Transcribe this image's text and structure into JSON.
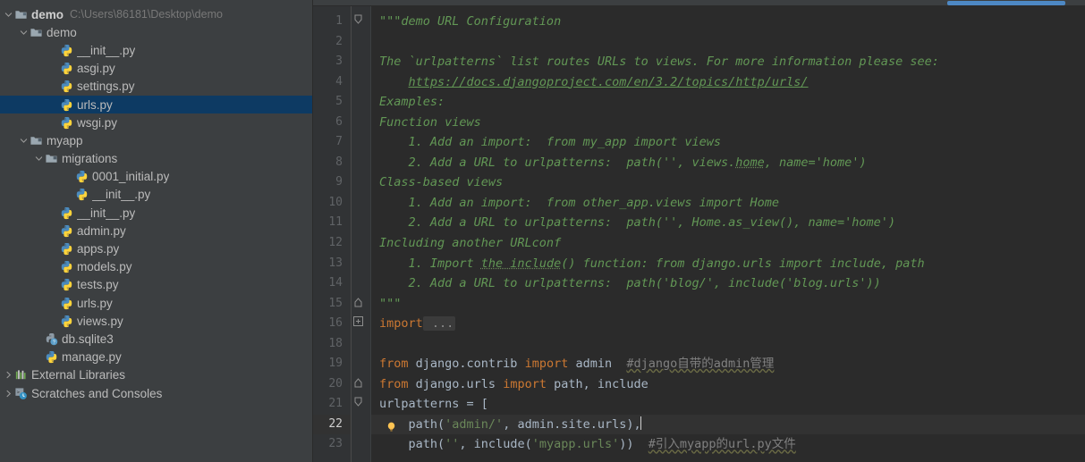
{
  "sidebar": {
    "items": [
      {
        "indent": 0,
        "arrow": "chevron-down",
        "icon": "folder-module",
        "label": "demo",
        "bold": true,
        "path": "C:\\Users\\86181\\Desktop\\demo",
        "selected": false
      },
      {
        "indent": 1,
        "arrow": "chevron-down",
        "icon": "folder-package",
        "label": "demo",
        "bold": false,
        "path": "",
        "selected": false
      },
      {
        "indent": 3,
        "arrow": "none",
        "icon": "python-file",
        "label": "__init__.py",
        "bold": false,
        "path": "",
        "selected": false
      },
      {
        "indent": 3,
        "arrow": "none",
        "icon": "python-file",
        "label": "asgi.py",
        "bold": false,
        "path": "",
        "selected": false
      },
      {
        "indent": 3,
        "arrow": "none",
        "icon": "python-file",
        "label": "settings.py",
        "bold": false,
        "path": "",
        "selected": false
      },
      {
        "indent": 3,
        "arrow": "none",
        "icon": "python-file",
        "label": "urls.py",
        "bold": false,
        "path": "",
        "selected": true
      },
      {
        "indent": 3,
        "arrow": "none",
        "icon": "python-file",
        "label": "wsgi.py",
        "bold": false,
        "path": "",
        "selected": false
      },
      {
        "indent": 1,
        "arrow": "chevron-down",
        "icon": "folder-package",
        "label": "myapp",
        "bold": false,
        "path": "",
        "selected": false
      },
      {
        "indent": 2,
        "arrow": "chevron-down",
        "icon": "folder-package",
        "label": "migrations",
        "bold": false,
        "path": "",
        "selected": false
      },
      {
        "indent": 4,
        "arrow": "none",
        "icon": "python-file",
        "label": "0001_initial.py",
        "bold": false,
        "path": "",
        "selected": false
      },
      {
        "indent": 4,
        "arrow": "none",
        "icon": "python-file",
        "label": "__init__.py",
        "bold": false,
        "path": "",
        "selected": false
      },
      {
        "indent": 3,
        "arrow": "none",
        "icon": "python-file",
        "label": "__init__.py",
        "bold": false,
        "path": "",
        "selected": false
      },
      {
        "indent": 3,
        "arrow": "none",
        "icon": "python-file",
        "label": "admin.py",
        "bold": false,
        "path": "",
        "selected": false
      },
      {
        "indent": 3,
        "arrow": "none",
        "icon": "python-file",
        "label": "apps.py",
        "bold": false,
        "path": "",
        "selected": false
      },
      {
        "indent": 3,
        "arrow": "none",
        "icon": "python-file",
        "label": "models.py",
        "bold": false,
        "path": "",
        "selected": false
      },
      {
        "indent": 3,
        "arrow": "none",
        "icon": "python-file",
        "label": "tests.py",
        "bold": false,
        "path": "",
        "selected": false
      },
      {
        "indent": 3,
        "arrow": "none",
        "icon": "python-file",
        "label": "urls.py",
        "bold": false,
        "path": "",
        "selected": false
      },
      {
        "indent": 3,
        "arrow": "none",
        "icon": "python-file",
        "label": "views.py",
        "bold": false,
        "path": "",
        "selected": false
      },
      {
        "indent": 2,
        "arrow": "none",
        "icon": "unknown-file",
        "label": "db.sqlite3",
        "bold": false,
        "path": "",
        "selected": false
      },
      {
        "indent": 2,
        "arrow": "none",
        "icon": "python-file",
        "label": "manage.py",
        "bold": false,
        "path": "",
        "selected": false
      },
      {
        "indent": 0,
        "arrow": "chevron-right",
        "icon": "libraries",
        "label": "External Libraries",
        "bold": false,
        "path": "",
        "selected": false
      },
      {
        "indent": 0,
        "arrow": "chevron-right",
        "icon": "scratches",
        "label": "Scratches and Consoles",
        "bold": false,
        "path": "",
        "selected": false
      }
    ]
  },
  "editor": {
    "scrollbar": {
      "thumb_left_pct": 82.2,
      "thumb_width_pct": 15.2,
      "color": "#4d88c4"
    },
    "current_line": 22,
    "first_visible_line": 1,
    "lines": [
      {
        "n": 1,
        "fold": "fold-start-doc",
        "html": "<span class=\"doc\">\"\"\"demo URL Configuration</span>"
      },
      {
        "n": 2,
        "fold": "",
        "html": ""
      },
      {
        "n": 3,
        "fold": "",
        "html": "<span class=\"doc\">The `urlpatterns` list routes URLs to views. For more information please see:</span>"
      },
      {
        "n": 4,
        "fold": "",
        "html": "<span class=\"doc\">    </span><span class=\"doclink\">https://docs.djangoproject.com/en/3.2/topics/http/urls/</span>"
      },
      {
        "n": 5,
        "fold": "",
        "html": "<span class=\"doc\">Examples:</span>"
      },
      {
        "n": 6,
        "fold": "",
        "html": "<span class=\"doc\">Function views</span>"
      },
      {
        "n": 7,
        "fold": "",
        "html": "<span class=\"doc\">    1. Add an import:  from my_app import views</span>"
      },
      {
        "n": 8,
        "fold": "",
        "html": "<span class=\"doc\">    2. Add a URL to urlpatterns:  path('', views.<span class=\"squig\">home</span>, name='home')</span>"
      },
      {
        "n": 9,
        "fold": "",
        "html": "<span class=\"doc\">Class-based views</span>"
      },
      {
        "n": 10,
        "fold": "",
        "html": "<span class=\"doc\">    1. Add an import:  from other_app.views import Home</span>"
      },
      {
        "n": 11,
        "fold": "",
        "html": "<span class=\"doc\">    2. Add a URL to urlpatterns:  path('', Home.as_view(), name='home')</span>"
      },
      {
        "n": 12,
        "fold": "",
        "html": "<span class=\"doc\">Including another URLconf</span>"
      },
      {
        "n": 13,
        "fold": "",
        "html": "<span class=\"doc\">    1. Import <span class=\"squig\">the include</span>() function: from django.urls import include, path</span>"
      },
      {
        "n": 14,
        "fold": "",
        "html": "<span class=\"doc\">    2. Add a URL to urlpatterns:  path('blog/', include('blog.urls'))</span>"
      },
      {
        "n": 15,
        "fold": "fold-end-doc",
        "html": "<span class=\"doc\">\"\"\"</span>"
      },
      {
        "n": 16,
        "fold": "fold-collapsed",
        "html": "<span class=\"kw\">import</span><span class=\"fold-placeholder\"> ...</span>"
      },
      {
        "n": 18,
        "fold": "",
        "html": ""
      },
      {
        "n": 19,
        "fold": "",
        "html": "<span class=\"kw\">from</span><span class=\"plain\"> django.contrib </span><span class=\"kw\">import</span><span class=\"plain\"> admin  </span><span class=\"cmt\">#django自带的admin管理</span>"
      },
      {
        "n": 20,
        "fold": "fold-end",
        "html": "<span class=\"kw\">from</span><span class=\"plain\"> django.urls </span><span class=\"kw\">import</span><span class=\"plain\"> path, include</span>"
      },
      {
        "n": 21,
        "fold": "fold-start",
        "html": "<span class=\"plain\">urlpatterns = [</span>"
      },
      {
        "n": 22,
        "fold": "",
        "gutter_icon": "lightbulb-icon",
        "html": "<span class=\"plain\">    path(</span><span class=\"str\">'admin/'</span><span class=\"plain\">, admin.site.urls),</span><span class=\"caret\"></span>"
      },
      {
        "n": 23,
        "fold": "",
        "html": "<span class=\"plain\">    path(</span><span class=\"str\">''</span><span class=\"plain\">, include(</span><span class=\"str\">'myapp.urls'</span><span class=\"plain\">))  </span><span class=\"cmt\">#引入myapp的url.py文件</span>"
      }
    ]
  }
}
